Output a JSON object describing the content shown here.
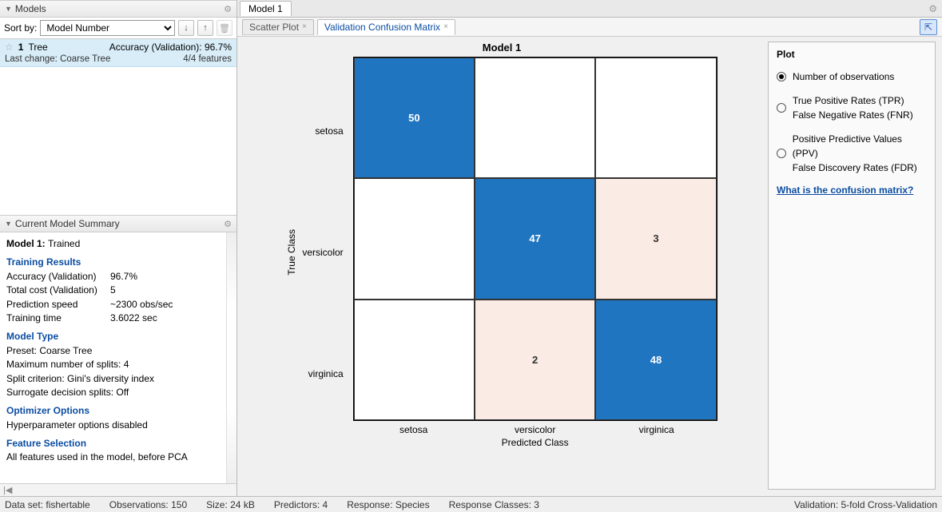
{
  "left": {
    "models_title": "Models",
    "sort_label": "Sort by:",
    "sort_value": "Model Number",
    "model_list": [
      {
        "num": "1",
        "name": "Tree",
        "accuracy_label": "Accuracy (Validation):",
        "accuracy_value": "96.7%",
        "last_change_label": "Last change:",
        "last_change_value": "Coarse Tree",
        "features": "4/4 features"
      }
    ],
    "summary_title": "Current Model Summary",
    "summary": {
      "model_name": "Model 1",
      "model_status": "Trained",
      "training_head": "Training Results",
      "acc_k": "Accuracy (Validation)",
      "acc_v": "96.7%",
      "cost_k": "Total cost (Validation)",
      "cost_v": "5",
      "speed_k": "Prediction speed",
      "speed_v": "~2300 obs/sec",
      "time_k": "Training time",
      "time_v": "3.6022 sec",
      "type_head": "Model Type",
      "preset": "Preset: Coarse Tree",
      "splits": "Maximum number of splits: 4",
      "criterion": "Split criterion: Gini's diversity index",
      "surrogate": "Surrogate decision splits: Off",
      "opt_head": "Optimizer Options",
      "opt_text": "Hyperparameter options disabled",
      "fs_head": "Feature Selection",
      "fs_text": "All features used in the model, before PCA"
    }
  },
  "center": {
    "model_tab": "Model 1",
    "plot_tabs": {
      "scatter": "Scatter Plot",
      "confusion": "Validation Confusion Matrix"
    },
    "chart_title": "Model 1",
    "ylabel": "True Class",
    "xlabel": "Predicted Class",
    "classes": [
      "setosa",
      "versicolor",
      "virginica"
    ]
  },
  "chart_data": {
    "type": "heatmap",
    "title": "Model 1",
    "xlabel": "Predicted Class",
    "ylabel": "True Class",
    "categories": [
      "setosa",
      "versicolor",
      "virginica"
    ],
    "matrix": [
      [
        50,
        0,
        0
      ],
      [
        0,
        47,
        3
      ],
      [
        0,
        2,
        48
      ]
    ]
  },
  "right": {
    "title": "Plot",
    "opt1": "Number of observations",
    "opt2a": "True Positive Rates (TPR)",
    "opt2b": "False Negative Rates (FNR)",
    "opt3a": "Positive Predictive Values (PPV)",
    "opt3b": "False Discovery Rates (FDR)",
    "link": "What is the confusion matrix?"
  },
  "status": {
    "dataset": "Data set: fishertable",
    "obs": "Observations: 150",
    "size": "Size: 24 kB",
    "pred": "Predictors: 4",
    "resp": "Response: Species",
    "classes": "Response Classes: 3",
    "validation": "Validation: 5-fold Cross-Validation"
  }
}
